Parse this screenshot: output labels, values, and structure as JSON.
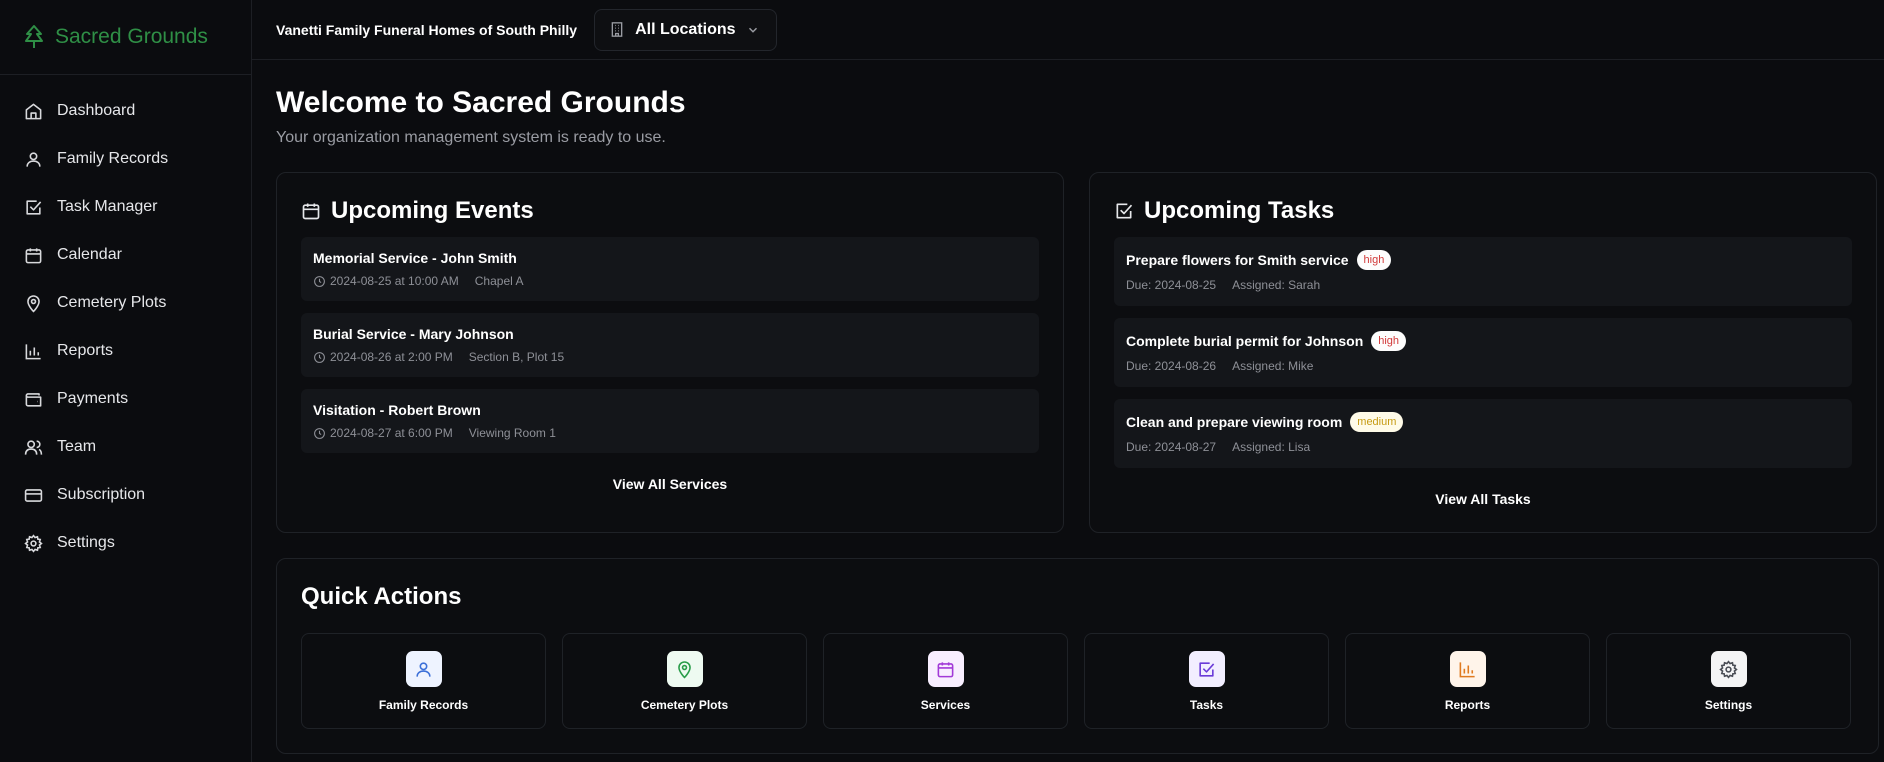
{
  "brand": {
    "name": "Sacred Grounds",
    "color": "#2f8f46"
  },
  "sidebar": {
    "items": [
      {
        "label": "Dashboard",
        "icon": "home-icon"
      },
      {
        "label": "Family Records",
        "icon": "user-icon"
      },
      {
        "label": "Task Manager",
        "icon": "check-square-icon"
      },
      {
        "label": "Calendar",
        "icon": "calendar-icon"
      },
      {
        "label": "Cemetery Plots",
        "icon": "map-pin-icon"
      },
      {
        "label": "Reports",
        "icon": "bar-chart-icon"
      },
      {
        "label": "Payments",
        "icon": "wallet-icon"
      },
      {
        "label": "Team",
        "icon": "users-icon"
      },
      {
        "label": "Subscription",
        "icon": "credit-card-icon"
      },
      {
        "label": "Settings",
        "icon": "gear-icon"
      }
    ]
  },
  "header": {
    "org_name": "Vanetti Family Funeral Homes of South Philly",
    "location_select": "All Locations"
  },
  "main": {
    "title": "Welcome to Sacred Grounds",
    "subtitle": "Your organization management system is ready to use."
  },
  "events": {
    "title": "Upcoming Events",
    "items": [
      {
        "title": "Memorial Service - John Smith",
        "datetime": "2024-08-25 at 10:00 AM",
        "location": "Chapel A"
      },
      {
        "title": "Burial Service - Mary Johnson",
        "datetime": "2024-08-26 at 2:00 PM",
        "location": "Section B, Plot 15"
      },
      {
        "title": "Visitation - Robert Brown",
        "datetime": "2024-08-27 at 6:00 PM",
        "location": "Viewing Room 1"
      }
    ],
    "view_all": "View All Services"
  },
  "tasks": {
    "title": "Upcoming Tasks",
    "items": [
      {
        "title": "Prepare flowers for Smith service",
        "priority": "high",
        "due": "Due: 2024-08-25",
        "assigned": "Assigned: Sarah"
      },
      {
        "title": "Complete burial permit for Johnson",
        "priority": "high",
        "due": "Due: 2024-08-26",
        "assigned": "Assigned: Mike"
      },
      {
        "title": "Clean and prepare viewing room",
        "priority": "medium",
        "due": "Due: 2024-08-27",
        "assigned": "Assigned: Lisa"
      }
    ],
    "view_all": "View All Tasks"
  },
  "quick_actions": {
    "title": "Quick Actions",
    "items": [
      {
        "label": "Family Records",
        "icon": "user-icon",
        "color": "#3b6fd8",
        "bg": "#eef3ff"
      },
      {
        "label": "Cemetery Plots",
        "icon": "map-pin-icon",
        "color": "#2a9d4a",
        "bg": "#eefaf1"
      },
      {
        "label": "Services",
        "icon": "calendar-icon",
        "color": "#a23ad8",
        "bg": "#f8eeff"
      },
      {
        "label": "Tasks",
        "icon": "check-square-icon",
        "color": "#6a3ad8",
        "bg": "#f2eeff"
      },
      {
        "label": "Reports",
        "icon": "bar-chart-icon",
        "color": "#e07a1f",
        "bg": "#fff4ea"
      },
      {
        "label": "Settings",
        "icon": "gear-icon",
        "color": "#4a4d55",
        "bg": "#f4f4f5"
      }
    ]
  }
}
